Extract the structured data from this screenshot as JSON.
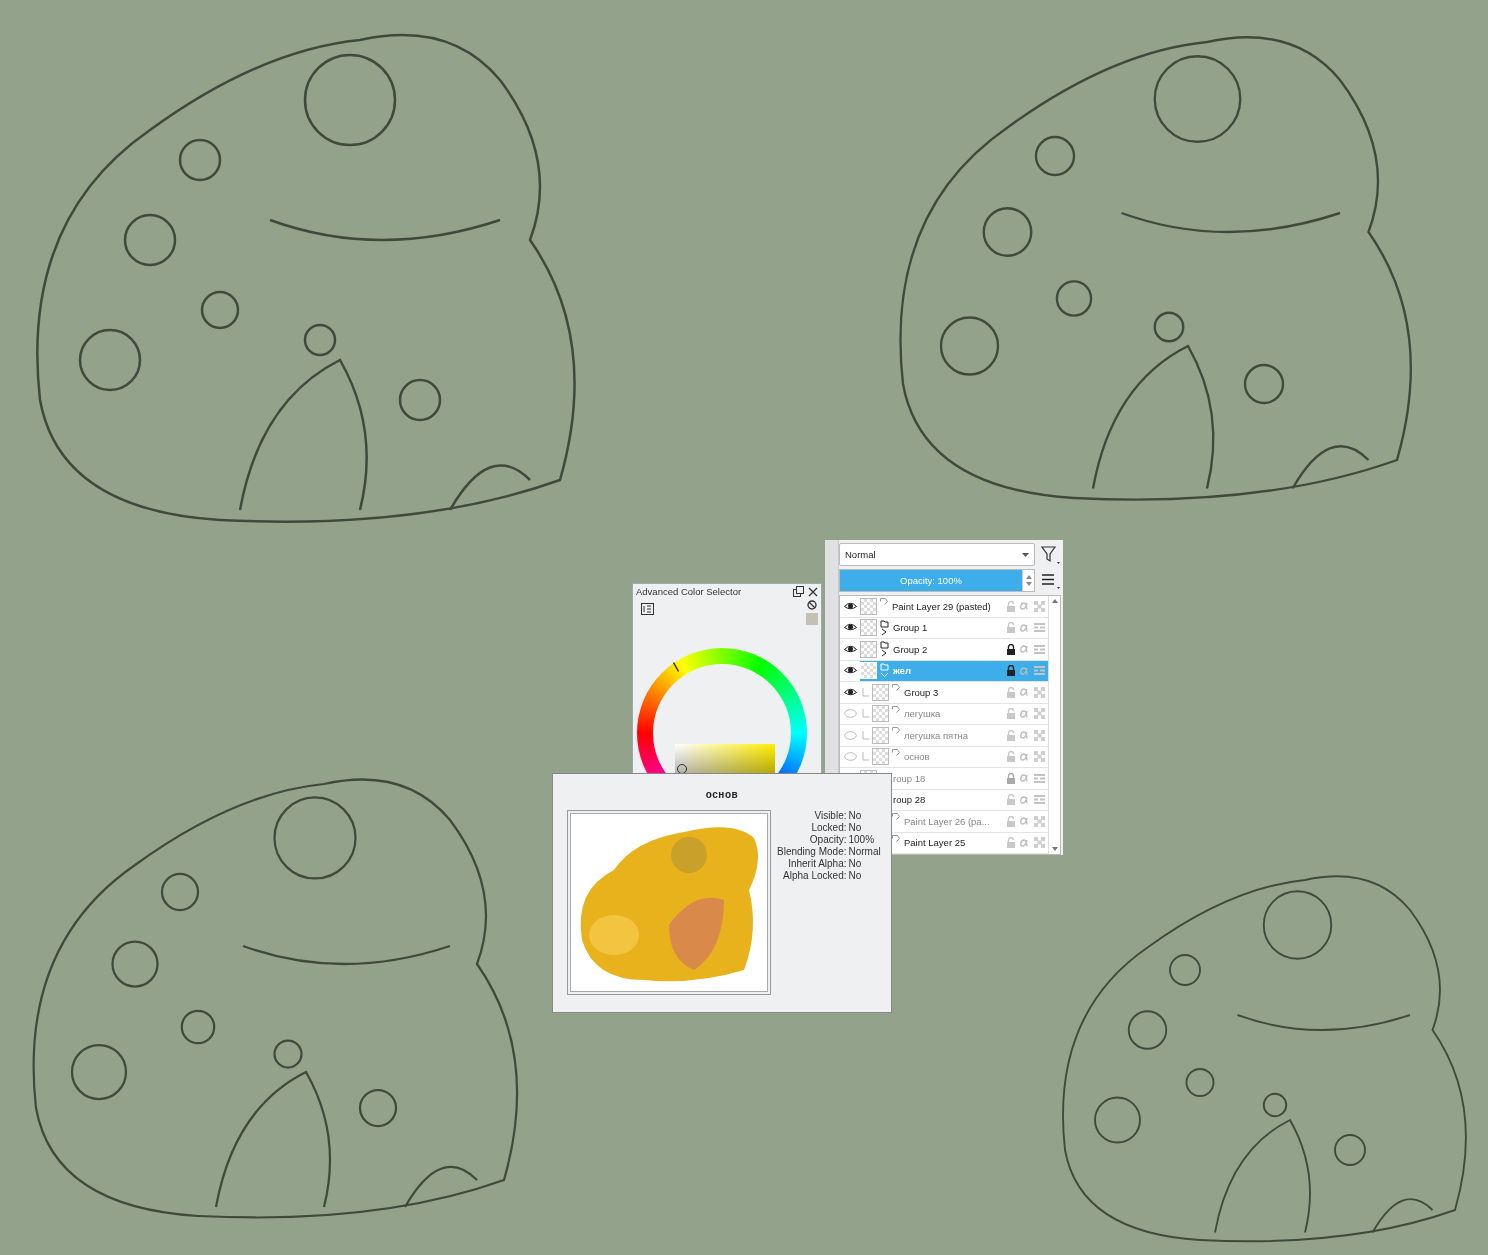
{
  "color_selector": {
    "title": "Advanced Color Selector"
  },
  "layers_docker": {
    "blend_mode": "Normal",
    "opacity": {
      "text": "Opacity:  100%",
      "level": 1
    },
    "layers": [
      {
        "name": "Paint Layer 29 (pasted)",
        "kind": "paint",
        "visible": true,
        "locked": false,
        "selected": false
      },
      {
        "name": "Group 1",
        "kind": "group",
        "visible": true,
        "locked": false,
        "selected": false,
        "expanded": false
      },
      {
        "name": "Group 2",
        "kind": "group",
        "visible": true,
        "locked": true,
        "selected": false,
        "expanded": false
      },
      {
        "name": "жел",
        "kind": "group",
        "visible": true,
        "locked": true,
        "selected": true,
        "expanded": true,
        "children": [
          {
            "name": "Group 3",
            "kind": "paint",
            "visible": true,
            "locked": false,
            "selected": false
          },
          {
            "name": "легушка",
            "kind": "paint",
            "visible": false,
            "locked": false,
            "selected": false
          },
          {
            "name": "легушка пятна",
            "kind": "paint",
            "visible": false,
            "locked": false,
            "selected": false
          },
          {
            "name": "основ",
            "kind": "paint",
            "visible": false,
            "locked": false,
            "selected": false
          }
        ]
      },
      {
        "name": "roup 18",
        "kind": "group",
        "visible": false,
        "locked": true,
        "selected": false
      },
      {
        "name": "roup 28",
        "kind": "group",
        "visible": true,
        "locked": false,
        "selected": false,
        "children": [
          {
            "name": "Paint Layer 26 (pa...",
            "kind": "paint",
            "visible": false,
            "locked": false,
            "selected": false
          },
          {
            "name": "Paint Layer 25",
            "kind": "paint",
            "visible": true,
            "locked": false,
            "selected": false
          }
        ]
      }
    ]
  },
  "layer_tooltip": {
    "title": "основ",
    "properties": [
      {
        "label": "Visible:",
        "value": "No"
      },
      {
        "label": "Locked:",
        "value": "No"
      },
      {
        "label": "Opacity:",
        "value": "100%"
      },
      {
        "label": "Blending Mode:",
        "value": "Normal"
      },
      {
        "label": "Inherit Alpha:",
        "value": "No"
      },
      {
        "label": "Alpha Locked:",
        "value": "No"
      }
    ]
  }
}
